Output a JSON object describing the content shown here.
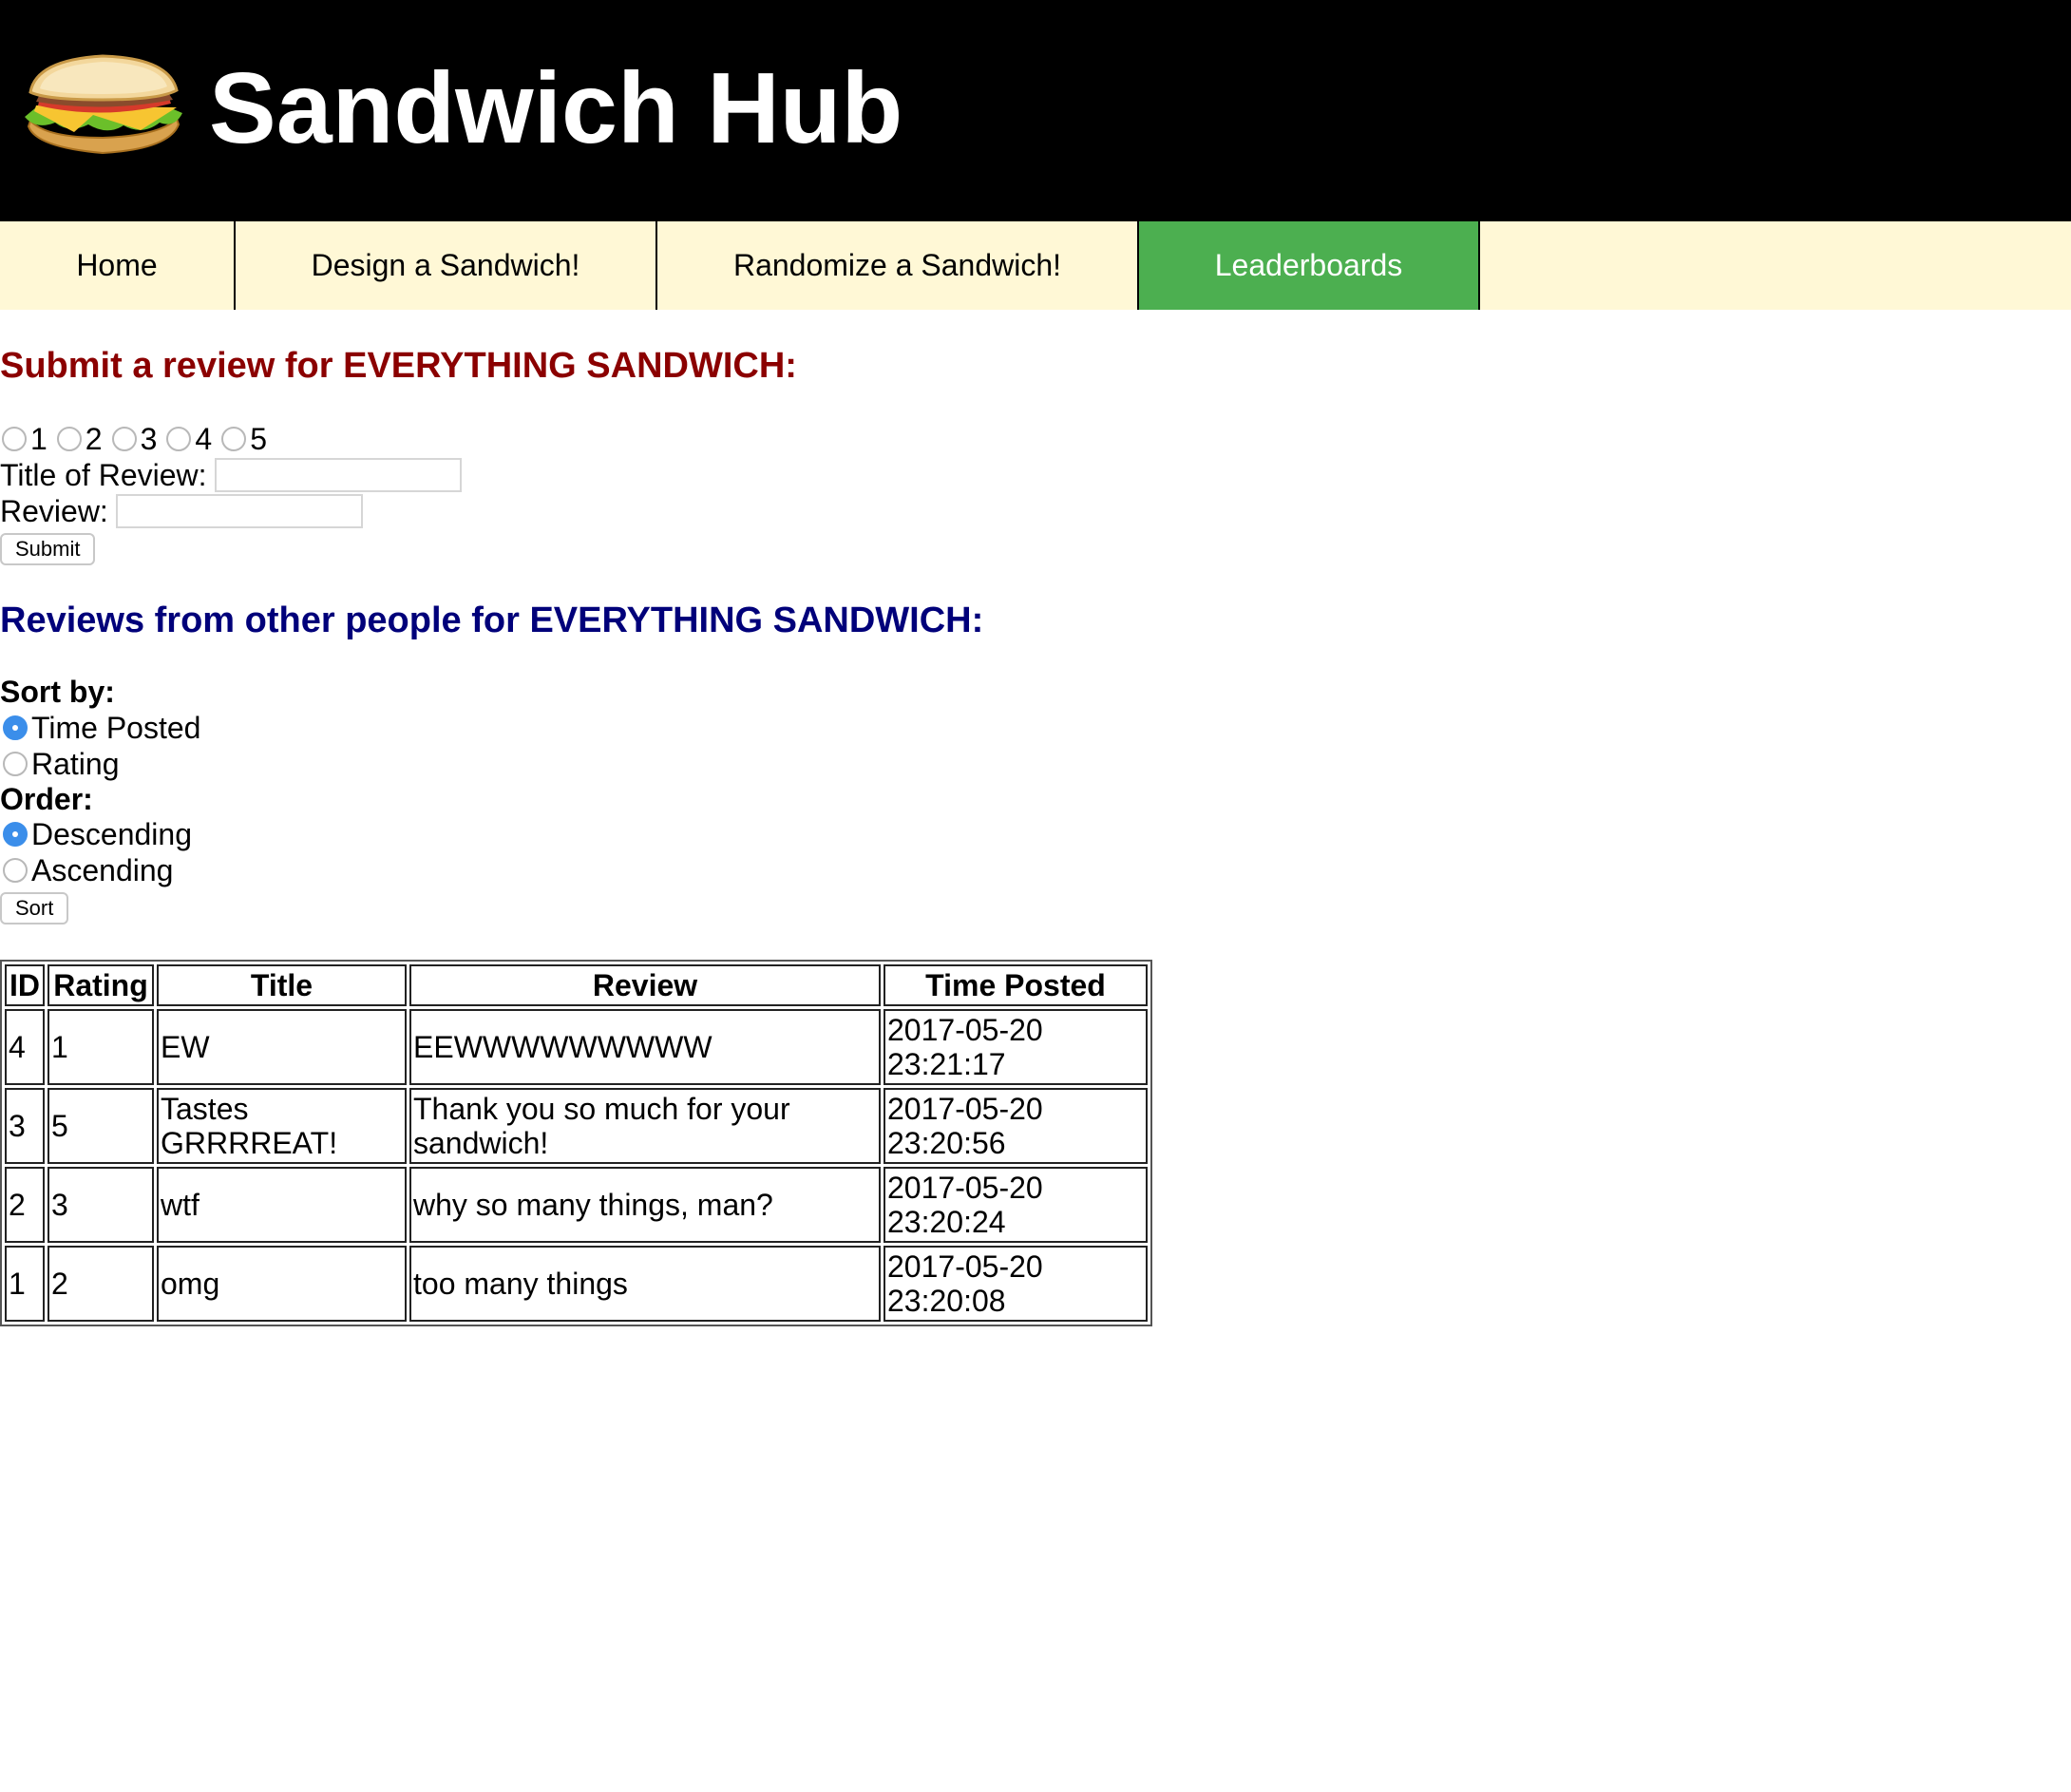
{
  "site": {
    "title": "Sandwich Hub",
    "logo_icon": "sandwich-logo"
  },
  "nav": {
    "items": [
      {
        "label": "Home",
        "active": false
      },
      {
        "label": "Design a Sandwich!",
        "active": false
      },
      {
        "label": "Randomize a Sandwich!",
        "active": false
      },
      {
        "label": "Leaderboards",
        "active": true
      }
    ]
  },
  "submit_form": {
    "heading": "Submit a review for EVERYTHING SANDWICH:",
    "rating_options": [
      "1",
      "2",
      "3",
      "4",
      "5"
    ],
    "title_label": "Title of Review:",
    "title_value": "",
    "review_label": "Review:",
    "review_value": "",
    "submit_label": "Submit"
  },
  "reviews_section": {
    "heading": "Reviews from other people for EVERYTHING SANDWICH:",
    "sort_by_label": "Sort by:",
    "sort_options": [
      {
        "label": "Time Posted",
        "checked": true
      },
      {
        "label": "Rating",
        "checked": false
      }
    ],
    "order_label": "Order:",
    "order_options": [
      {
        "label": "Descending",
        "checked": true
      },
      {
        "label": "Ascending",
        "checked": false
      }
    ],
    "sort_button": "Sort"
  },
  "table": {
    "headers": [
      "ID",
      "Rating",
      "Title",
      "Review",
      "Time Posted"
    ],
    "rows": [
      {
        "id": "4",
        "rating": "1",
        "title": "EW",
        "review": "EEWWWWWWWWW",
        "date": "2017-05-20",
        "time": "23:21:17"
      },
      {
        "id": "3",
        "rating": "5",
        "title": "Tastes GRRRREAT!",
        "review": "Thank you so much for your sandwich!",
        "date": "2017-05-20",
        "time": "23:20:56"
      },
      {
        "id": "2",
        "rating": "3",
        "title": "wtf",
        "review": "why so many things, man?",
        "date": "2017-05-20",
        "time": "23:20:24"
      },
      {
        "id": "1",
        "rating": "2",
        "title": "omg",
        "review": "too many things",
        "date": "2017-05-20",
        "time": "23:20:08"
      }
    ]
  },
  "colors": {
    "header_bg": "#000000",
    "nav_bg": "#fff8d6",
    "nav_active": "#4caf50",
    "submit_heading": "#8b0000",
    "reviews_heading": "#00007a",
    "radio_checked": "#3b8eea"
  }
}
